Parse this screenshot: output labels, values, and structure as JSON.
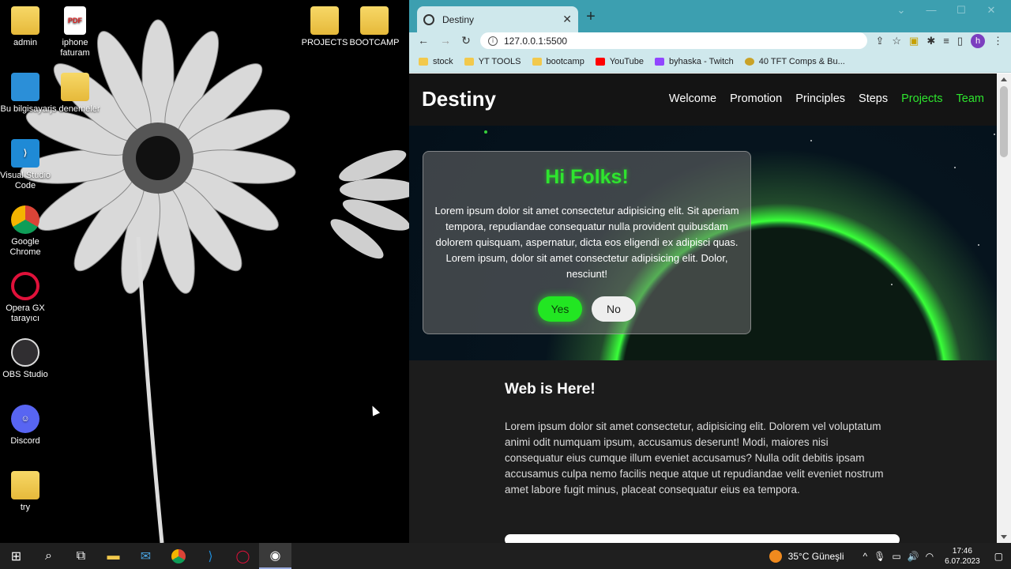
{
  "desktop": {
    "icons": [
      {
        "label": "admin",
        "icon": "user-folder-icon"
      },
      {
        "label": "iphone faturam",
        "icon": "pdf-file-icon"
      },
      {
        "label": "PROJECTS",
        "icon": "folder-icon"
      },
      {
        "label": "BOOTCAMP",
        "icon": "folder-icon"
      },
      {
        "label": "Bu bilgisayar",
        "icon": "computer-icon"
      },
      {
        "label": "js denemeler",
        "icon": "folder-icon"
      },
      {
        "label": "Visual Studio Code",
        "icon": "vscode-icon"
      },
      {
        "label": "Google Chrome",
        "icon": "chrome-icon"
      },
      {
        "label": "Opera GX tarayıcı",
        "icon": "opera-icon"
      },
      {
        "label": "OBS Studio",
        "icon": "obs-icon"
      },
      {
        "label": "Discord",
        "icon": "discord-icon"
      },
      {
        "label": "try",
        "icon": "folder-icon"
      }
    ]
  },
  "browser": {
    "tab_title": "Destiny",
    "url": "127.0.0.1:5500",
    "bookmarks": [
      {
        "label": "stock",
        "color": "#f2c94c"
      },
      {
        "label": "YT TOOLS",
        "color": "#f2c94c"
      },
      {
        "label": "bootcamp",
        "color": "#f2c94c"
      },
      {
        "label": "YouTube",
        "color": "#ff0000"
      },
      {
        "label": "byhaska - Twitch",
        "color": "#9146ff"
      },
      {
        "label": "40 TFT Comps & Bu...",
        "color": "#c9a227"
      }
    ],
    "avatar_letter": "h"
  },
  "site": {
    "brand": "Destiny",
    "nav": [
      "Welcome",
      "Promotion",
      "Principles",
      "Steps",
      "Projects",
      "Team"
    ],
    "hero": {
      "heading": "Hi Folks!",
      "text": "Lorem ipsum dolor sit amet consectetur adipisicing elit. Sit aperiam tempora, repudiandae consequatur nulla provident quibusdam dolorem quisquam, aspernatur, dicta eos eligendi ex adipisci quas. Lorem ipsum, dolor sit amet consectetur adipisicing elit. Dolor, nesciunt!",
      "yes_label": "Yes",
      "no_label": "No"
    },
    "section": {
      "heading": "Web is Here!",
      "text": "Lorem ipsum dolor sit amet consectetur, adipisicing elit. Dolorem vel voluptatum animi odit numquam ipsum, accusamus deserunt! Modi, maiores nisi consequatur eius cumque illum eveniet accusamus? Nulla odit debitis ipsam accusamus culpa nemo facilis neque atque ut repudiandae velit eveniet nostrum amet labore fugit minus, placeat consequatur eius ea tempora."
    },
    "accent_color": "#2ee52e"
  },
  "taskbar": {
    "weather": "35°C Güneşli",
    "time": "17:46",
    "date": "6.07.2023"
  }
}
